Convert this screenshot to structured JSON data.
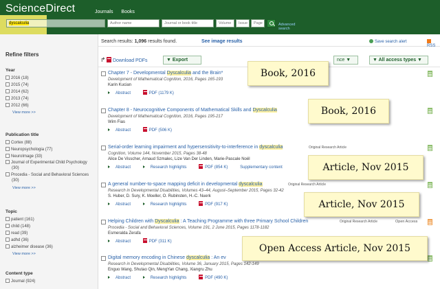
{
  "header": {
    "logo": "ScienceDirect",
    "nav": [
      "Journals",
      "Books"
    ],
    "search": {
      "query": "dyscalculia",
      "author_placeholder": "Author name",
      "journal_placeholder": "Journal or book title",
      "volume_placeholder": "Volume",
      "issue_placeholder": "Issue",
      "page_placeholder": "Page",
      "advanced": "Advanced search"
    }
  },
  "results_bar": {
    "label": "Search results:",
    "count": "1,096",
    "suffix": "results found.",
    "see_images": "See image results",
    "save_alert": "Save search alert",
    "rss": "RSS"
  },
  "toolbar": {
    "download": "Download PDFs",
    "export": "Export",
    "sort_partial": "nce",
    "access": "All access types"
  },
  "sidebar": {
    "title": "Refine filters",
    "groups": [
      {
        "heading": "Year",
        "items": [
          "2016  (18)",
          "2015  (74)",
          "2014  (62)",
          "2013  (74)",
          "2012  (66)"
        ],
        "more": "View more >>"
      },
      {
        "heading": "Publication title",
        "items": [
          "Cortex  (88)",
          "Neuropsychologia  (77)",
          "NeuroImage  (33)",
          "Journal of Experimental Child Psychology  (30)",
          "Procedia - Social and Behavioral Sciences  (30)"
        ],
        "more": "View more >>"
      },
      {
        "heading": "Topic",
        "items": [
          "patient  (161)",
          "child  (148)",
          "read  (39)",
          "adhd  (36)",
          "alzheimer disease  (36)"
        ],
        "more": "View more >>"
      },
      {
        "heading": "Content type",
        "items": [
          "Journal  (924)"
        ],
        "more": ""
      }
    ]
  },
  "results": [
    {
      "title_pre": "Chapter 7 - Developmental ",
      "title_hl": "Dyscalculia",
      "title_post": " and the Brain*",
      "type": "",
      "source": "Development of Mathematical Cognition, 2016, Pages 165-193",
      "authors": "Karin Kucian",
      "links": [
        "Abstract",
        "PDF (1179 K)"
      ]
    },
    {
      "title_pre": "Chapter 8 - Neurocognitive Components of Mathematical Skills and ",
      "title_hl": "Dyscalculia",
      "title_post": "",
      "type": "",
      "source": "Development of Mathematical Cognition, 2016, Pages 195-217",
      "authors": "Wim Fias",
      "links": [
        "Abstract",
        "PDF (506 K)"
      ]
    },
    {
      "title_pre": "Serial-order learning impairment and hypersensitivity-to-interference in ",
      "title_hl": "dyscalculia",
      "title_post": "",
      "type": "Original Research Article",
      "source": "Cognition, Volume 144, November 2015, Pages 38-48",
      "authors": "Alice De Visscher, Arnaud Szmalec, Lize Van Der Linden, Marie-Pascale Noël",
      "links": [
        "Abstract",
        "Research highlights",
        "PDF (854 K)",
        "Supplementary content"
      ]
    },
    {
      "title_pre": "A general number-to-space mapping deficit in developmental ",
      "title_hl": "dyscalculia",
      "title_post": "",
      "type": "Original Research Article",
      "source": "Research in Developmental Disabilities, Volumes 43–44, August–September 2015, Pages 32-42",
      "authors": "S. Huber, D. Sury, K. Moeller, O. Rubinsten, H.-C. Nuerk",
      "links": [
        "Abstract",
        "Research highlights",
        "PDF (917 K)"
      ]
    },
    {
      "title_pre": "Helping Children with ",
      "title_hl": "Dyscalculia",
      "title_post": " : A Teaching Programme with three Primary School Children",
      "type": "Original Research Article",
      "open_access": "Open Access",
      "source": "Procedia - Social and Behavioral Sciences, Volume 191, 2 June 2015, Pages 1178-1182",
      "authors": "Esmeralda Zerafa",
      "links": [
        "Abstract",
        "PDF (311 K)"
      ]
    },
    {
      "title_pre": "Digital memory encoding in Chinese ",
      "title_hl": "dyscalculia",
      "title_post": " : An ev",
      "type": "",
      "source": "Research in Developmental Disabilities, Volume 36, January 2015, Pages 142-149",
      "authors": "Enguo Wang, Shutao Qin, MengYan Chang, Xiangru Zhu",
      "links": [
        "Abstract",
        "Research highlights",
        "PDF (490 K)"
      ]
    }
  ],
  "annotations": [
    "Book, 2016",
    "Book, 2016",
    "Article, Nov 2015",
    "Article, Nov 2015",
    "Open Access Article, Nov 2015"
  ],
  "colors": {
    "header_green": "#1d5e2a",
    "link_blue": "#2961a8",
    "highlight": "#fff26a",
    "note_yellow": "#fffacd"
  }
}
